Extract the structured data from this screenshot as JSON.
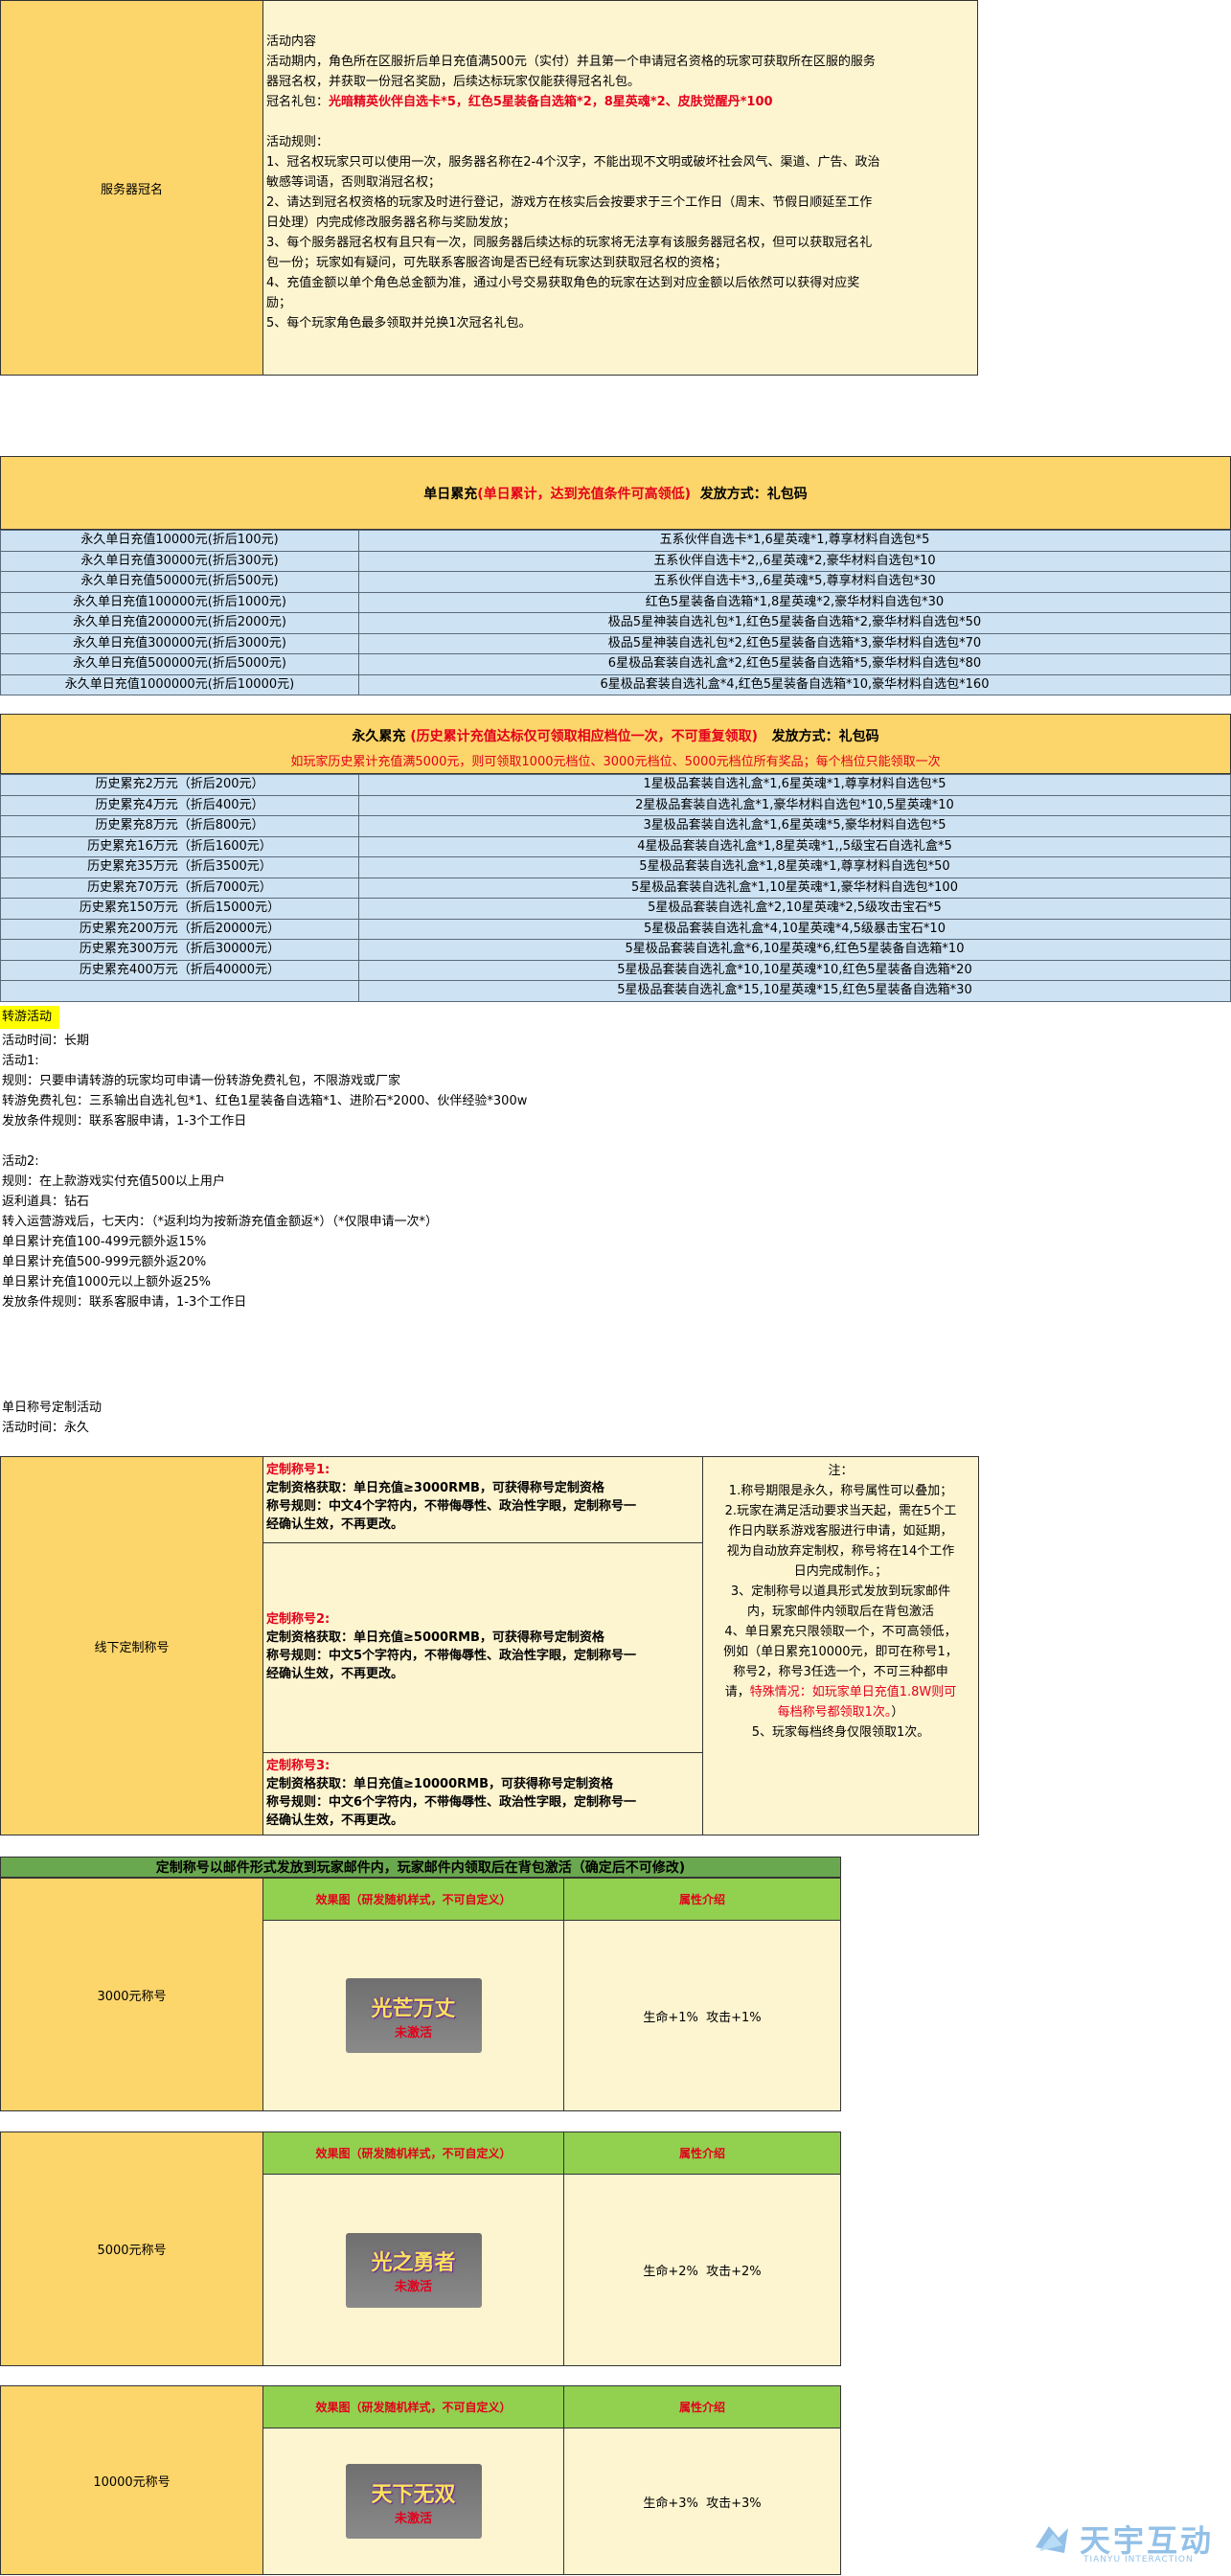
{
  "server_naming": {
    "label": "服务器冠名",
    "content_title": "活动内容",
    "content_line1": "活动期内，角色所在区服折后单日充值满500元（实付）并且第一个申请冠名资格的玩家可获取所在区服的服务",
    "content_line2": "器冠名权，并获取一份冠名奖励，后续达标玩家仅能获得冠名礼包。",
    "gift_label": "冠名礼包：",
    "gift_value": "光暗精英伙伴自选卡*5，红色5星装备自选箱*2，8星英魂*2、皮肤觉醒丹*100",
    "rules_title": "活动规则：",
    "rules": [
      "1、冠名权玩家只可以使用一次，服务器名称在2-4个汉字，不能出现不文明或破坏社会风气、渠道、广告、政治",
      "敏感等词语，否则取消冠名权；",
      "2、请达到冠名权资格的玩家及时进行登记，游戏方在核实后会按要求于三个工作日（周末、节假日顺延至工作",
      "日处理）内完成修改服务器名称与奖励发放；",
      "3、每个服务器冠名权有且只有一次，同服务器后续达标的玩家将无法享有该服务器冠名权，但可以获取冠名礼",
      "包一份；玩家如有疑问，可先联系客服咨询是否已经有玩家达到获取冠名权的资格；",
      "4、充值金额以单个角色总金额为准，通过小号交易获取角色的玩家在达到对应金额以后依然可以获得对应奖",
      "励；",
      "5、每个玩家角色最多领取并兑换1次冠名礼包。"
    ]
  },
  "daily": {
    "head_prefix": "单日累充",
    "head_red": "(单日累计，达到充值条件可高领低)",
    "head_suffix": "  发放方式：礼包码",
    "rows": [
      [
        "永久单日充值10000元(折后100元)",
        "五系伙伴自选卡*1,6星英魂*1,尊享材料自选包*5"
      ],
      [
        "永久单日充值30000元(折后300元)",
        "五系伙伴自选卡*2,,6星英魂*2,豪华材料自选包*10"
      ],
      [
        "永久单日充值50000元(折后500元)",
        "五系伙伴自选卡*3,,6星英魂*5,尊享材料自选包*30"
      ],
      [
        "永久单日充值100000元(折后1000元)",
        "红色5星装备自选箱*1,8星英魂*2,豪华材料自选包*30"
      ],
      [
        "永久单日充值200000元(折后2000元)",
        "极品5星神装自选礼包*1,红色5星装备自选箱*2,豪华材料自选包*50"
      ],
      [
        "永久单日充值300000元(折后3000元)",
        "极品5星神装自选礼包*2,红色5星装备自选箱*3,豪华材料自选包*70"
      ],
      [
        "永久单日充值500000元(折后5000元)",
        "6星极品套装自选礼盒*2,红色5星装备自选箱*5,豪华材料自选包*80"
      ],
      [
        "永久单日充值1000000元(折后10000元)",
        "6星极品套装自选礼盒*4,红色5星装备自选箱*10,豪华材料自选包*160"
      ]
    ]
  },
  "history": {
    "head_prefix": "永久累充",
    "head_red": "(历史累计充值达标仅可领取相应档位一次，不可重复领取)",
    "head_suffix": "  发放方式：礼包码",
    "sub": "如玩家历史累计充值满5000元，则可领取1000元档位、3000元档位、5000元档位所有奖品；每个档位只能领取一次",
    "rows": [
      [
        "历史累充2万元（折后200元）",
        "1星极品套装自选礼盒*1,6星英魂*1,尊享材料自选包*5"
      ],
      [
        "历史累充4万元（折后400元）",
        "2星极品套装自选礼盒*1,豪华材料自选包*10,5星英魂*10"
      ],
      [
        "历史累充8万元（折后800元）",
        "3星极品套装自选礼盒*1,6星英魂*5,豪华材料自选包*5"
      ],
      [
        "历史累充16万元（折后1600元）",
        "4星极品套装自选礼盒*1,8星英魂*1,,5级宝石自选礼盒*5"
      ],
      [
        "历史累充35万元（折后3500元）",
        "5星极品套装自选礼盒*1,8星英魂*1,尊享材料自选包*50"
      ],
      [
        "历史累充70万元（折后7000元）",
        "5星极品套装自选礼盒*1,10星英魂*1,豪华材料自选包*100"
      ],
      [
        "历史累充150万元（折后15000元）",
        "5星极品套装自选礼盒*2,10星英魂*2,5级攻击宝石*5"
      ],
      [
        "历史累充200万元（折后20000元）",
        "5星极品套装自选礼盒*4,10星英魂*4,5级暴击宝石*10"
      ],
      [
        "历史累充300万元（折后30000元）",
        "5星极品套装自选礼盒*6,10星英魂*6,红色5星装备自选箱*10"
      ],
      [
        "历史累充400万元（折后40000元）",
        "5星极品套装自选礼盒*10,10星英魂*10,红色5星装备自选箱*20"
      ],
      [
        "",
        "5星极品套装自选礼盒*15,10星英魂*15,红色5星装备自选箱*30"
      ]
    ]
  },
  "transfer": {
    "title": "转游活动",
    "lines": [
      "活动时间：长期",
      "活动1:",
      "规则：只要申请转游的玩家均可申请一份转游免费礼包，不限游戏或厂家",
      "转游免费礼包：三系输出自选礼包*1、红色1星装备自选箱*1、进阶石*2000、伙伴经验*300w",
      "发放条件规则：联系客服申请，1-3个工作日",
      "",
      "活动2:",
      "规则：在上款游戏实付充值500以上用户",
      "返利道具：钻石",
      "转入运营游戏后，七天内：（*返利均为按新游充值金额返*）（*仅限申请一次*）",
      "单日累计充值100-499元额外返15%",
      "单日累计充值500-999元额外返20%",
      "单日累计充值1000元以上额外返25%",
      "发放条件规则：联系客服申请，1-3个工作日"
    ]
  },
  "custom": {
    "title": "单日称号定制活动",
    "time": "活动时间：永久",
    "label": "线下定制称号",
    "tiers": [
      {
        "name": "定制称号1:",
        "l1": "定制资格获取：单日充值≥3000RMB，可获得称号定制资格",
        "l2": "称号规则：中文4个字符内，不带侮辱性、政治性字眼，定制称号一",
        "l3": "经确认生效，不再更改。"
      },
      {
        "name": "定制称号2:",
        "l1": "定制资格获取：单日充值≥5000RMB，可获得称号定制资格",
        "l2": "称号规则：中文5个字符内，不带侮辱性、政治性字眼，定制称号一",
        "l3": "经确认生效，不再更改。"
      },
      {
        "name": "定制称号3:",
        "l1": "定制资格获取：单日充值≥10000RMB，可获得称号定制资格",
        "l2": "称号规则：中文6个字符内，不带侮辱性、政治性字眼，定制称号一",
        "l3": "经确认生效，不再更改。"
      }
    ],
    "note_title": "注：",
    "notes": [
      "1.称号期限是永久，称号属性可以叠加；",
      "2.玩家在满足活动要求当天起，需在5个工",
      "作日内联系游戏客服进行申请，如延期，",
      "视为自动放弃定制权，称号将在14个工作",
      "日内完成制作。；",
      "3、定制称号以道具形式发放到玩家邮件",
      "内，玩家邮件内领取后在背包激活",
      "4、单日累充只限领取一个，不可高领低，",
      "例如（单日累充10000元，即可在称号1，",
      "称号2，称号3任选一个，不可三种都申"
    ],
    "note_red_prefix": "请，",
    "note_red1": "特殊情况：如玩家单日充值1.8W则可",
    "note_red2": "每档称号都领取1次。",
    "note_red_suffix": "）",
    "note_last": "5、玩家每档终身仅限领取1次。"
  },
  "titles": {
    "banner": "定制称号以邮件形式发放到玩家邮件内，玩家邮件内领取后在背包激活（确定后不可修改)",
    "effect_header": "效果图（研发随机样式，不可自定义）",
    "attr_header": "属性介绍",
    "items": [
      {
        "label": "3000元称号",
        "art": "光芒万丈",
        "art_sub": "未激活",
        "attr": "生命+1%  攻击+1%"
      },
      {
        "label": "5000元称号",
        "art": "光之勇者",
        "art_sub": "未激活",
        "attr": "生命+2%  攻击+2%"
      },
      {
        "label": "10000元称号",
        "art": "天下无双",
        "art_sub": "未激活",
        "attr": "生命+3%  攻击+3%"
      }
    ]
  },
  "watermark": {
    "name": "天宇互动",
    "sub": "TIANYU INTERACTION"
  }
}
